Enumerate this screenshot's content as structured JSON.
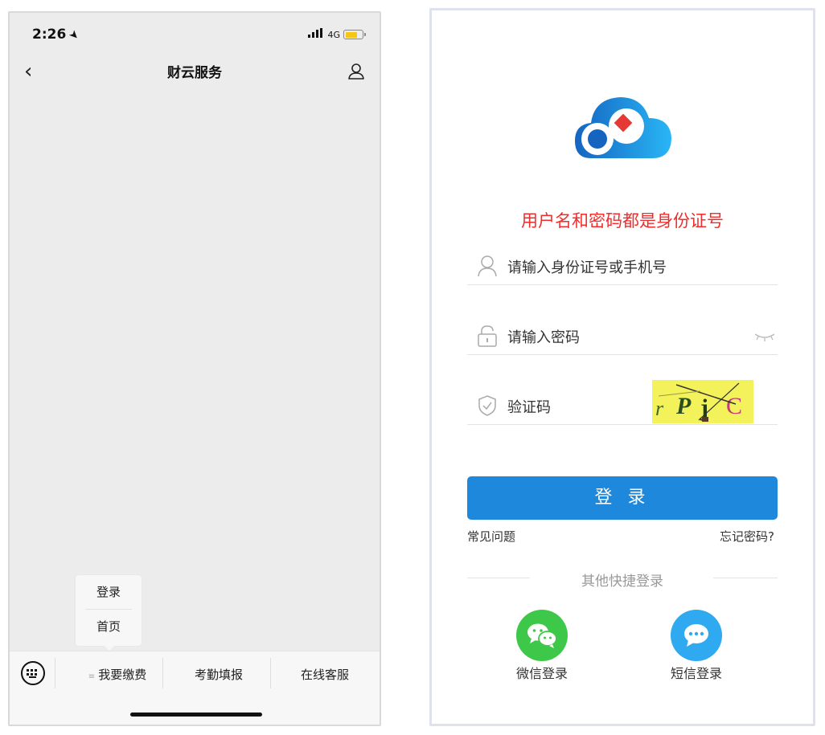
{
  "left_screen": {
    "status": {
      "time": "2:26",
      "network": "4G",
      "signal": "ıll"
    },
    "nav": {
      "back": "‹",
      "title": "财云服务"
    },
    "popup": {
      "items": [
        "登录",
        "首页"
      ]
    },
    "bottom_tabs": [
      {
        "label": "我要缴费",
        "menu_mark": "≡"
      },
      {
        "label": "考勤填报"
      },
      {
        "label": "在线客服"
      }
    ]
  },
  "right_screen": {
    "hint": "用户名和密码都是身份证号",
    "username": {
      "placeholder": "请输入身份证号或手机号"
    },
    "password": {
      "placeholder": "请输入密码"
    },
    "captcha": {
      "placeholder": "验证码",
      "image_text": "r P j C"
    },
    "login_button": "登 录",
    "faq_link": "常见问题",
    "forgot_link": "忘记密码?",
    "other_login_title": "其他快捷登录",
    "wechat_login": "微信登录",
    "sms_login": "短信登录",
    "colors": {
      "primary": "#1e88dd",
      "hint": "#f02d2d",
      "wechat": "#3ec84a",
      "sms": "#2fa9f0",
      "captcha_bg": "#f4f25a"
    }
  }
}
